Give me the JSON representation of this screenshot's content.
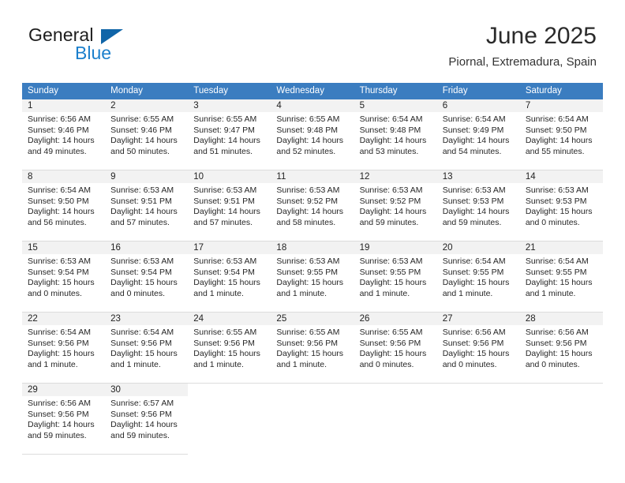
{
  "logo": {
    "word1": "General",
    "word2": "Blue",
    "triangle_color": "#1065a8",
    "blue_text_color": "#1b7fcc"
  },
  "header": {
    "month_title": "June 2025",
    "location": "Piornal, Extremadura, Spain"
  },
  "theme": {
    "header_row_bg": "#3b7dc0",
    "header_row_text": "#ffffff",
    "daynum_band_bg": "#f2f2f2",
    "cell_border": "#dcdcdc",
    "page_bg": "#ffffff"
  },
  "calendar": {
    "weekday_headers": [
      "Sunday",
      "Monday",
      "Tuesday",
      "Wednesday",
      "Thursday",
      "Friday",
      "Saturday"
    ],
    "weeks": [
      [
        {
          "day": "1",
          "sunrise": "Sunrise: 6:56 AM",
          "sunset": "Sunset: 9:46 PM",
          "daylight1": "Daylight: 14 hours",
          "daylight2": "and 49 minutes."
        },
        {
          "day": "2",
          "sunrise": "Sunrise: 6:55 AM",
          "sunset": "Sunset: 9:46 PM",
          "daylight1": "Daylight: 14 hours",
          "daylight2": "and 50 minutes."
        },
        {
          "day": "3",
          "sunrise": "Sunrise: 6:55 AM",
          "sunset": "Sunset: 9:47 PM",
          "daylight1": "Daylight: 14 hours",
          "daylight2": "and 51 minutes."
        },
        {
          "day": "4",
          "sunrise": "Sunrise: 6:55 AM",
          "sunset": "Sunset: 9:48 PM",
          "daylight1": "Daylight: 14 hours",
          "daylight2": "and 52 minutes."
        },
        {
          "day": "5",
          "sunrise": "Sunrise: 6:54 AM",
          "sunset": "Sunset: 9:48 PM",
          "daylight1": "Daylight: 14 hours",
          "daylight2": "and 53 minutes."
        },
        {
          "day": "6",
          "sunrise": "Sunrise: 6:54 AM",
          "sunset": "Sunset: 9:49 PM",
          "daylight1": "Daylight: 14 hours",
          "daylight2": "and 54 minutes."
        },
        {
          "day": "7",
          "sunrise": "Sunrise: 6:54 AM",
          "sunset": "Sunset: 9:50 PM",
          "daylight1": "Daylight: 14 hours",
          "daylight2": "and 55 minutes."
        }
      ],
      [
        {
          "day": "8",
          "sunrise": "Sunrise: 6:54 AM",
          "sunset": "Sunset: 9:50 PM",
          "daylight1": "Daylight: 14 hours",
          "daylight2": "and 56 minutes."
        },
        {
          "day": "9",
          "sunrise": "Sunrise: 6:53 AM",
          "sunset": "Sunset: 9:51 PM",
          "daylight1": "Daylight: 14 hours",
          "daylight2": "and 57 minutes."
        },
        {
          "day": "10",
          "sunrise": "Sunrise: 6:53 AM",
          "sunset": "Sunset: 9:51 PM",
          "daylight1": "Daylight: 14 hours",
          "daylight2": "and 57 minutes."
        },
        {
          "day": "11",
          "sunrise": "Sunrise: 6:53 AM",
          "sunset": "Sunset: 9:52 PM",
          "daylight1": "Daylight: 14 hours",
          "daylight2": "and 58 minutes."
        },
        {
          "day": "12",
          "sunrise": "Sunrise: 6:53 AM",
          "sunset": "Sunset: 9:52 PM",
          "daylight1": "Daylight: 14 hours",
          "daylight2": "and 59 minutes."
        },
        {
          "day": "13",
          "sunrise": "Sunrise: 6:53 AM",
          "sunset": "Sunset: 9:53 PM",
          "daylight1": "Daylight: 14 hours",
          "daylight2": "and 59 minutes."
        },
        {
          "day": "14",
          "sunrise": "Sunrise: 6:53 AM",
          "sunset": "Sunset: 9:53 PM",
          "daylight1": "Daylight: 15 hours",
          "daylight2": "and 0 minutes."
        }
      ],
      [
        {
          "day": "15",
          "sunrise": "Sunrise: 6:53 AM",
          "sunset": "Sunset: 9:54 PM",
          "daylight1": "Daylight: 15 hours",
          "daylight2": "and 0 minutes."
        },
        {
          "day": "16",
          "sunrise": "Sunrise: 6:53 AM",
          "sunset": "Sunset: 9:54 PM",
          "daylight1": "Daylight: 15 hours",
          "daylight2": "and 0 minutes."
        },
        {
          "day": "17",
          "sunrise": "Sunrise: 6:53 AM",
          "sunset": "Sunset: 9:54 PM",
          "daylight1": "Daylight: 15 hours",
          "daylight2": "and 1 minute."
        },
        {
          "day": "18",
          "sunrise": "Sunrise: 6:53 AM",
          "sunset": "Sunset: 9:55 PM",
          "daylight1": "Daylight: 15 hours",
          "daylight2": "and 1 minute."
        },
        {
          "day": "19",
          "sunrise": "Sunrise: 6:53 AM",
          "sunset": "Sunset: 9:55 PM",
          "daylight1": "Daylight: 15 hours",
          "daylight2": "and 1 minute."
        },
        {
          "day": "20",
          "sunrise": "Sunrise: 6:54 AM",
          "sunset": "Sunset: 9:55 PM",
          "daylight1": "Daylight: 15 hours",
          "daylight2": "and 1 minute."
        },
        {
          "day": "21",
          "sunrise": "Sunrise: 6:54 AM",
          "sunset": "Sunset: 9:55 PM",
          "daylight1": "Daylight: 15 hours",
          "daylight2": "and 1 minute."
        }
      ],
      [
        {
          "day": "22",
          "sunrise": "Sunrise: 6:54 AM",
          "sunset": "Sunset: 9:56 PM",
          "daylight1": "Daylight: 15 hours",
          "daylight2": "and 1 minute."
        },
        {
          "day": "23",
          "sunrise": "Sunrise: 6:54 AM",
          "sunset": "Sunset: 9:56 PM",
          "daylight1": "Daylight: 15 hours",
          "daylight2": "and 1 minute."
        },
        {
          "day": "24",
          "sunrise": "Sunrise: 6:55 AM",
          "sunset": "Sunset: 9:56 PM",
          "daylight1": "Daylight: 15 hours",
          "daylight2": "and 1 minute."
        },
        {
          "day": "25",
          "sunrise": "Sunrise: 6:55 AM",
          "sunset": "Sunset: 9:56 PM",
          "daylight1": "Daylight: 15 hours",
          "daylight2": "and 1 minute."
        },
        {
          "day": "26",
          "sunrise": "Sunrise: 6:55 AM",
          "sunset": "Sunset: 9:56 PM",
          "daylight1": "Daylight: 15 hours",
          "daylight2": "and 0 minutes."
        },
        {
          "day": "27",
          "sunrise": "Sunrise: 6:56 AM",
          "sunset": "Sunset: 9:56 PM",
          "daylight1": "Daylight: 15 hours",
          "daylight2": "and 0 minutes."
        },
        {
          "day": "28",
          "sunrise": "Sunrise: 6:56 AM",
          "sunset": "Sunset: 9:56 PM",
          "daylight1": "Daylight: 15 hours",
          "daylight2": "and 0 minutes."
        }
      ],
      [
        {
          "day": "29",
          "sunrise": "Sunrise: 6:56 AM",
          "sunset": "Sunset: 9:56 PM",
          "daylight1": "Daylight: 14 hours",
          "daylight2": "and 59 minutes."
        },
        {
          "day": "30",
          "sunrise": "Sunrise: 6:57 AM",
          "sunset": "Sunset: 9:56 PM",
          "daylight1": "Daylight: 14 hours",
          "daylight2": "and 59 minutes."
        },
        {
          "day": "",
          "sunrise": "",
          "sunset": "",
          "daylight1": "",
          "daylight2": ""
        },
        {
          "day": "",
          "sunrise": "",
          "sunset": "",
          "daylight1": "",
          "daylight2": ""
        },
        {
          "day": "",
          "sunrise": "",
          "sunset": "",
          "daylight1": "",
          "daylight2": ""
        },
        {
          "day": "",
          "sunrise": "",
          "sunset": "",
          "daylight1": "",
          "daylight2": ""
        },
        {
          "day": "",
          "sunrise": "",
          "sunset": "",
          "daylight1": "",
          "daylight2": ""
        }
      ]
    ]
  }
}
